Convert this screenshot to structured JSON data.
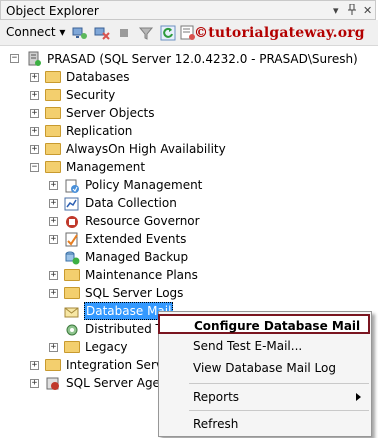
{
  "window": {
    "title": "Object Explorer",
    "pin_glyph": "▾",
    "autohide_glyph": "📌",
    "close_glyph": "✕"
  },
  "toolbar": {
    "connect_label": "Connect ▾",
    "brand": "©tutorialgateway.org"
  },
  "tree": {
    "server": "PRASAD (SQL Server 12.0.4232.0 - PRASAD\\Suresh)",
    "databases": "Databases",
    "security": "Security",
    "server_objects": "Server Objects",
    "replication": "Replication",
    "alwayson": "AlwaysOn High Availability",
    "management": "Management",
    "policy_management": "Policy Management",
    "data_collection": "Data Collection",
    "resource_governor": "Resource Governor",
    "extended_events": "Extended Events",
    "managed_backup": "Managed Backup",
    "maintenance_plans": "Maintenance Plans",
    "sql_server_logs": "SQL Server Logs",
    "database_mail": "Database Mail",
    "distributed_tr": "Distributed Tr",
    "legacy": "Legacy",
    "integration_services": "Integration Servic",
    "sql_server_agent": "SQL Server Agent"
  },
  "context_menu": {
    "configure": "Configure Database Mail",
    "send_test": "Send Test E-Mail...",
    "view_log": "View Database Mail Log",
    "reports": "Reports",
    "refresh": "Refresh"
  },
  "colors": {
    "brand": "#b30000",
    "selection": "#3399ff",
    "highlight_border": "#7a1520",
    "folder": "#f3cf6e"
  }
}
